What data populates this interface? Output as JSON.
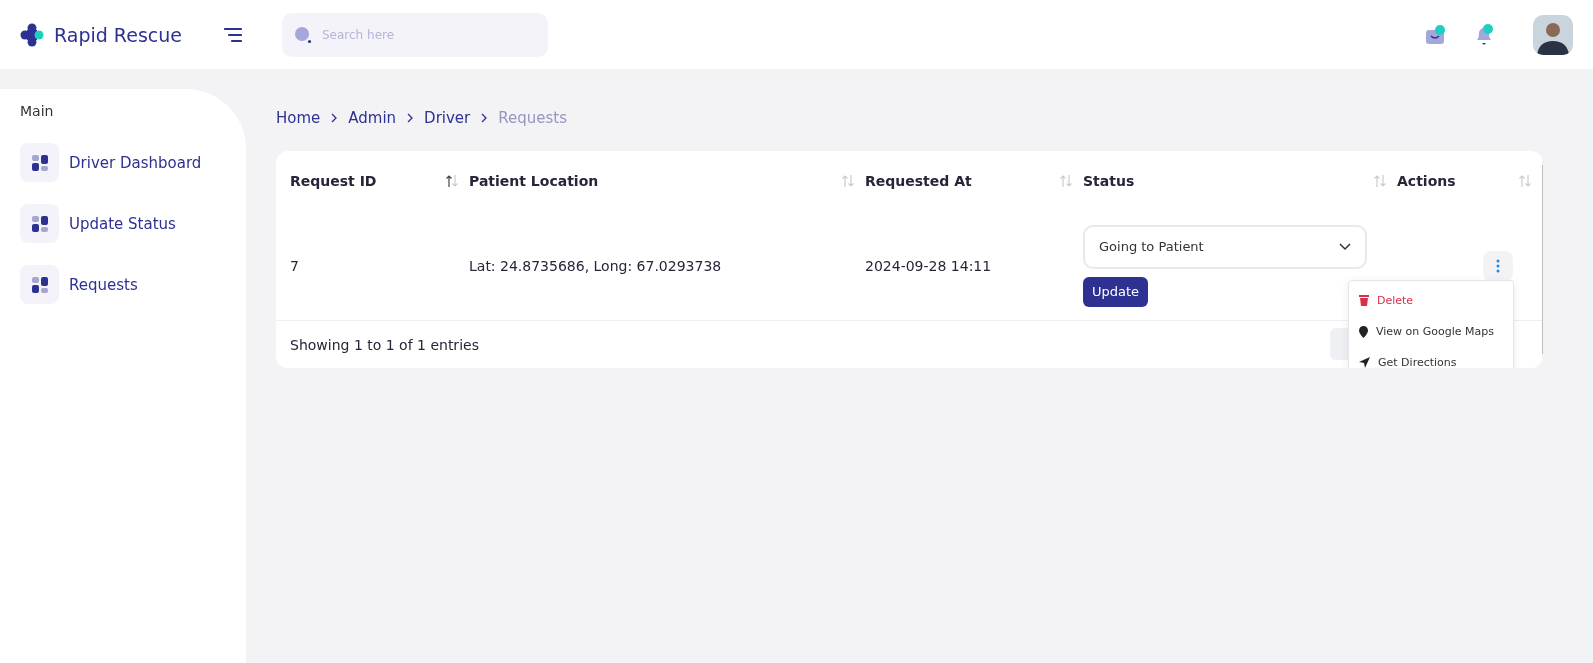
{
  "brand": {
    "name": "Rapid Rescue"
  },
  "search": {
    "placeholder": "Search here"
  },
  "notifications": [
    {
      "kind": "mail",
      "unread": true
    },
    {
      "kind": "bell",
      "unread": true
    }
  ],
  "sidebar": {
    "heading": "Main",
    "items": [
      {
        "label": "Driver Dashboard"
      },
      {
        "label": "Update Status"
      },
      {
        "label": "Requests"
      }
    ]
  },
  "breadcrumb": [
    {
      "label": "Home",
      "current": false
    },
    {
      "label": "Admin",
      "current": false
    },
    {
      "label": "Driver",
      "current": false
    },
    {
      "label": "Requests",
      "current": true
    }
  ],
  "table": {
    "columns": [
      {
        "label": "Request ID",
        "sorted": true
      },
      {
        "label": "Patient Location",
        "sorted": false
      },
      {
        "label": "Requested At",
        "sorted": false
      },
      {
        "label": "Status",
        "sorted": false
      },
      {
        "label": "Actions",
        "sorted": false
      }
    ],
    "rows": [
      {
        "id": "7",
        "location": "Lat: 24.8735686, Long: 67.0293738",
        "requested_at": "2024-09-28 14:11",
        "status": "Going to Patient",
        "update_button": "Update"
      }
    ],
    "footer": "Showing 1 to 1 of 1 entries"
  },
  "action_menu": {
    "open": true,
    "items": [
      {
        "kind": "delete",
        "label": "Delete"
      },
      {
        "kind": "map",
        "label": "View on Google Maps"
      },
      {
        "kind": "directions",
        "label": "Get Directions"
      }
    ]
  }
}
